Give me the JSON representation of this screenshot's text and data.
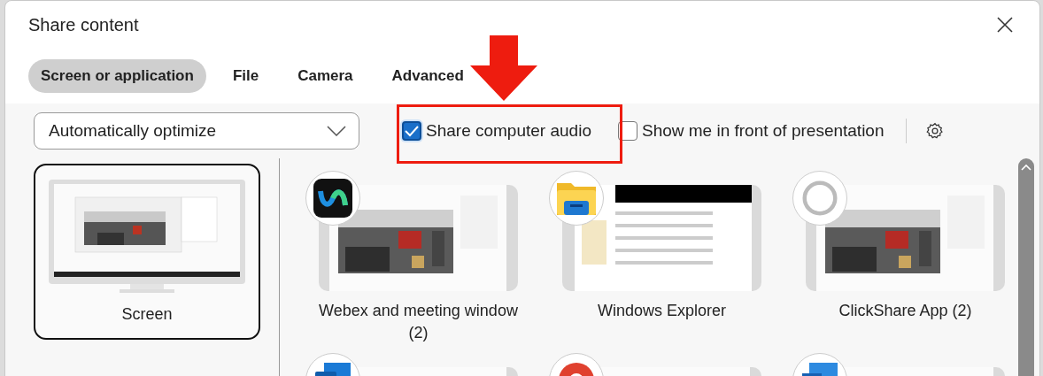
{
  "window": {
    "title": "Share content"
  },
  "tabs": [
    {
      "label": "Screen or application",
      "selected": true
    },
    {
      "label": "File",
      "selected": false
    },
    {
      "label": "Camera",
      "selected": false
    },
    {
      "label": "Advanced",
      "selected": false
    }
  ],
  "optimize_dropdown": {
    "value": "Automatically optimize"
  },
  "options": [
    {
      "label": "Share computer audio",
      "checked": true
    },
    {
      "label": "Show me in front of presentation",
      "checked": false
    }
  ],
  "screen": {
    "label": "Screen",
    "selected": true
  },
  "apps": [
    {
      "kind": "webex",
      "label": "Webex and meeting window (2)",
      "selected": false
    },
    {
      "kind": "explorer",
      "label": "Windows Explorer",
      "selected": false
    },
    {
      "kind": "clickshare",
      "label": "ClickShare App (2)",
      "selected": false
    },
    {
      "kind": "outlook",
      "selected": false
    },
    {
      "kind": "chrome",
      "selected": false
    },
    {
      "kind": "office",
      "selected": false
    }
  ]
}
